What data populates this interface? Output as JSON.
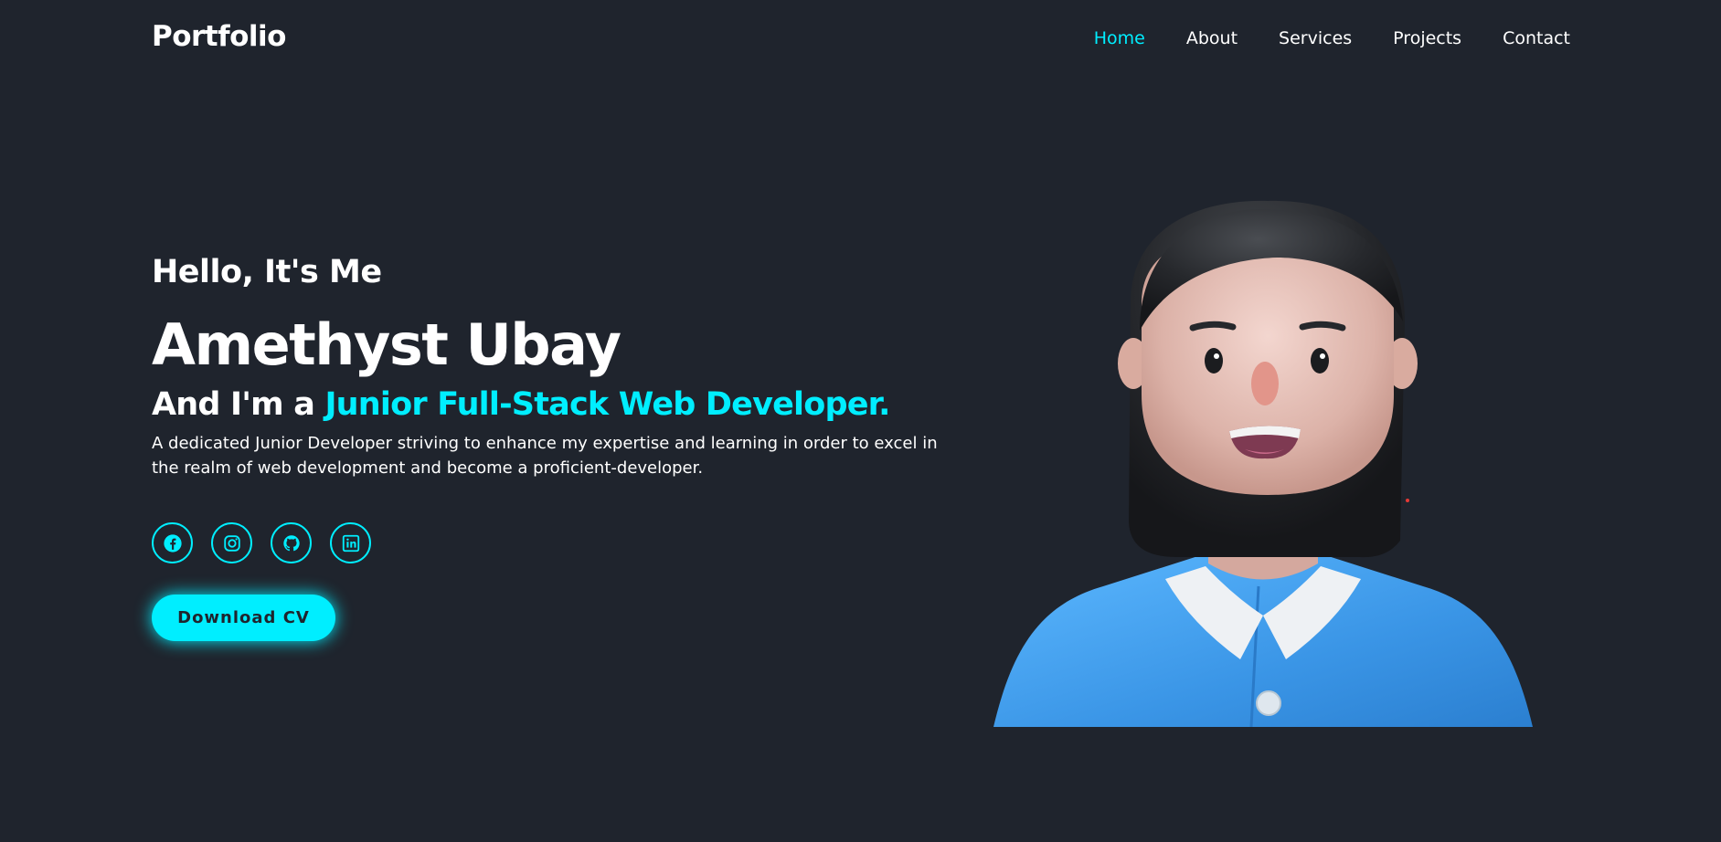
{
  "header": {
    "logo": "Portfolio",
    "nav": [
      {
        "label": "Home",
        "active": true
      },
      {
        "label": "About",
        "active": false
      },
      {
        "label": "Services",
        "active": false
      },
      {
        "label": "Projects",
        "active": false
      },
      {
        "label": "Contact",
        "active": false
      }
    ]
  },
  "hero": {
    "greeting": "Hello, It's Me",
    "name": "Amethyst Ubay",
    "role_prefix": "And I'm a ",
    "role_highlight": "Junior Full-Stack Web Developer.",
    "description": "A dedicated Junior Developer striving to enhance my expertise and learning in order to excel in the realm of web development and become a proficient-developer.",
    "socials": [
      {
        "icon": "facebook-icon"
      },
      {
        "icon": "instagram-icon"
      },
      {
        "icon": "github-icon"
      },
      {
        "icon": "linkedin-icon"
      }
    ],
    "cv_button": "Download CV"
  },
  "colors": {
    "background": "#1f242d",
    "accent": "#00eeff",
    "text": "#ffffff"
  }
}
